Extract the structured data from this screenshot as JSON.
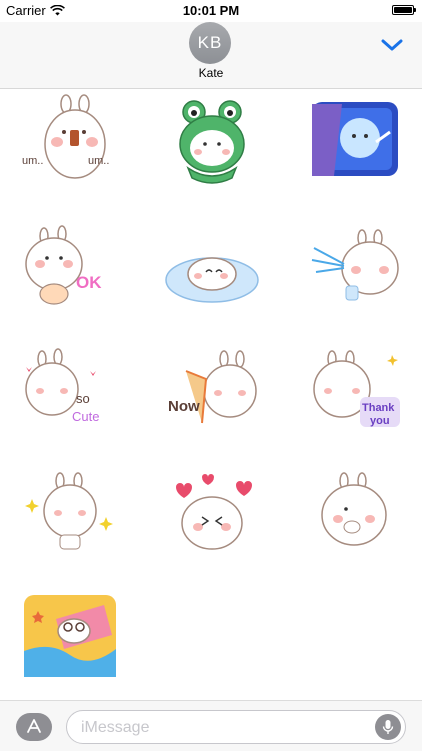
{
  "status_bar": {
    "carrier": "Carrier",
    "time": "10:01 PM",
    "battery_level": 1.0
  },
  "header": {
    "avatar_initials": "KB",
    "contact_name": "Kate"
  },
  "stickers": [
    {
      "name": "sticker-bunny-um",
      "texts": [
        "um..",
        "um.."
      ]
    },
    {
      "name": "sticker-frog-costume",
      "texts": []
    },
    {
      "name": "sticker-window-bubble",
      "texts": []
    },
    {
      "name": "sticker-bunny-ok",
      "texts": [
        "OK"
      ]
    },
    {
      "name": "sticker-bunny-puddle",
      "texts": []
    },
    {
      "name": "sticker-bunny-water-spray",
      "texts": []
    },
    {
      "name": "sticker-bunny-so-cute",
      "texts": [
        "so",
        "Cute"
      ]
    },
    {
      "name": "sticker-bunny-now",
      "texts": [
        "Now"
      ]
    },
    {
      "name": "sticker-bunny-thank-you",
      "texts": [
        "Thank",
        "you"
      ]
    },
    {
      "name": "sticker-bunny-sparkle",
      "texts": []
    },
    {
      "name": "sticker-bunny-hearts",
      "texts": []
    },
    {
      "name": "sticker-bunny-shy",
      "texts": []
    },
    {
      "name": "sticker-bunny-beach",
      "texts": []
    }
  ],
  "composer": {
    "placeholder": "iMessage"
  },
  "colors": {
    "accent": "#1a73e8",
    "blush": "#f7b8b5",
    "outline": "#a58b7f"
  }
}
